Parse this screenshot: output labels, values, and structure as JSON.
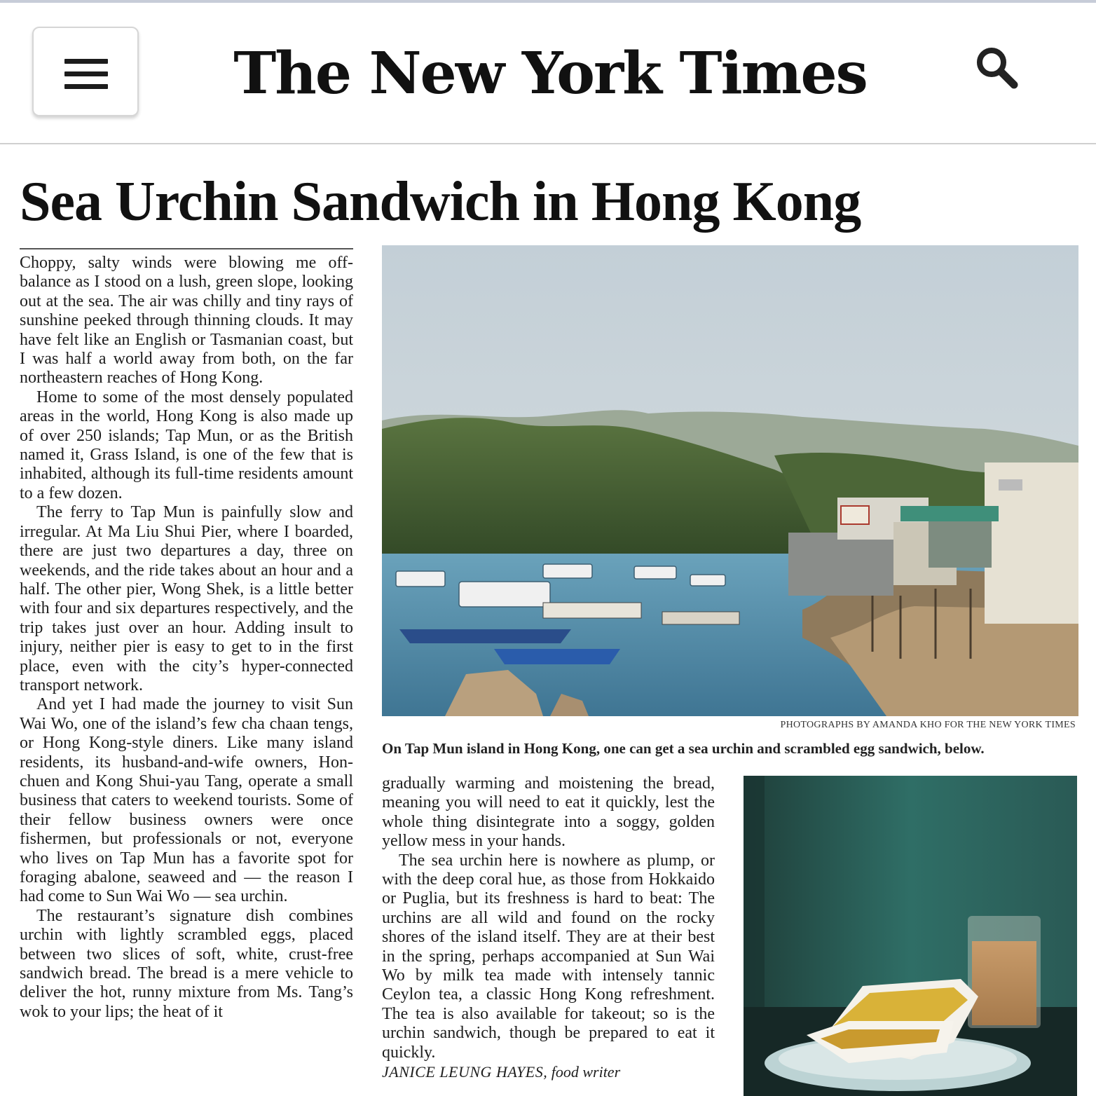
{
  "masthead": {
    "title": "The New York Times",
    "menu_icon": "hamburger-menu-icon",
    "search_icon": "search-icon"
  },
  "article": {
    "headline": "Sea Urchin Sandwich in Hong Kong",
    "column1": [
      "Choppy, salty winds were blowing me off-balance as I stood on a lush, green slope, looking out at the sea. The air was chilly and tiny rays of sunshine peeked through thinning clouds. It may have felt like an English or Tasmanian coast, but I was half a world away from both, on the far northeastern reaches of Hong Kong.",
      "Home to some of the most densely populated areas in the world, Hong Kong is also made up of over 250 islands; Tap Mun, or as the British named it, Grass Island, is one of the few that is inhabited, although its full-time residents amount to a few dozen.",
      "The ferry to Tap Mun is painfully slow and irregular. At Ma Liu Shui Pier, where I boarded, there are just two departures a day, three on weekends, and the ride takes about an hour and a half. The other pier, Wong Shek, is a little better with four and six departures respectively, and the trip takes just over an hour. Adding insult to injury, neither pier is easy to get to in the first place, even with the city’s hyper-connected transport network.",
      "And yet I had made the journey to visit Sun Wai Wo, one of the island’s few cha chaan tengs, or Hong Kong-style diners. Like many island residents, its husband-and-wife owners, Hon-chuen and Kong Shui-yau Tang, operate a small business that caters to weekend tourists. Some of their fellow business owners were once fishermen, but professionals or not, everyone who lives on Tap Mun has a favorite spot for foraging abalone, seaweed and — the reason I had come to Sun Wai Wo — sea urchin.",
      "The restaurant’s signature dish combines urchin with lightly scrambled eggs, placed between two slices of soft, white, crust-free sandwich bread. The bread is a mere vehicle to deliver the hot, runny mixture from Ms. Tang’s wok to your lips; the heat of it"
    ],
    "column2": [
      "gradually warming and moistening the bread, meaning you will need to eat it quickly, lest the whole thing disintegrate into a soggy, golden yellow mess in your hands.",
      "The sea urchin here is nowhere as plump, or with the deep coral hue, as those from Hokkaido or Puglia, but its freshness is hard to beat: The urchins are all wild and found on the rocky shores of the island itself. They are at their best in the spring, perhaps accompanied at Sun Wai Wo by milk tea made with intensely tannic Ceylon tea, a classic Hong Kong refreshment. The tea is also available for takeout; so is the urchin sandwich, though be prepared to eat it quickly."
    ],
    "byline_name": "JANICE LEUNG HAYES,",
    "byline_role": "food writer",
    "photo_credit": "PHOTOGRAPHS BY AMANDA KHO FOR THE NEW YORK TIMES",
    "photo_caption": "On Tap Mun island in Hong Kong, one can get a sea urchin and scrambled egg sandwich, below."
  },
  "colors": {
    "text": "#1d1d1d",
    "rule": "#cfcfcf",
    "sky": "#c9d4db",
    "sea": "#5a93ad",
    "hill": "#3e5a2c",
    "teal_wall": "#2f6e66"
  }
}
